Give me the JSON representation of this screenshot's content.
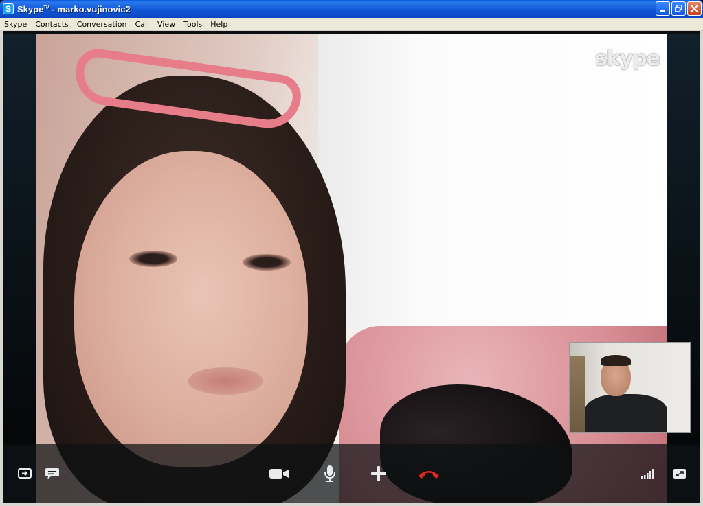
{
  "window": {
    "app_name": "Skype",
    "trademark": "TM",
    "title_suffix": " - marko.vujinovic2"
  },
  "menubar": {
    "items": [
      "Skype",
      "Contacts",
      "Conversation",
      "Call",
      "View",
      "Tools",
      "Help"
    ]
  },
  "video": {
    "watermark": "skype"
  },
  "controls": {
    "icons": [
      "screen-share-icon",
      "chat-icon",
      "video-camera-icon",
      "microphone-icon",
      "add-icon",
      "hang-up-icon",
      "signal-strength-icon",
      "fullscreen-icon"
    ],
    "hangup_color": "#e0281c"
  },
  "colors": {
    "titlebar": "#0a54d8",
    "menubar_bg": "#ece9d8",
    "controlbar_bg": "#0c1014"
  }
}
